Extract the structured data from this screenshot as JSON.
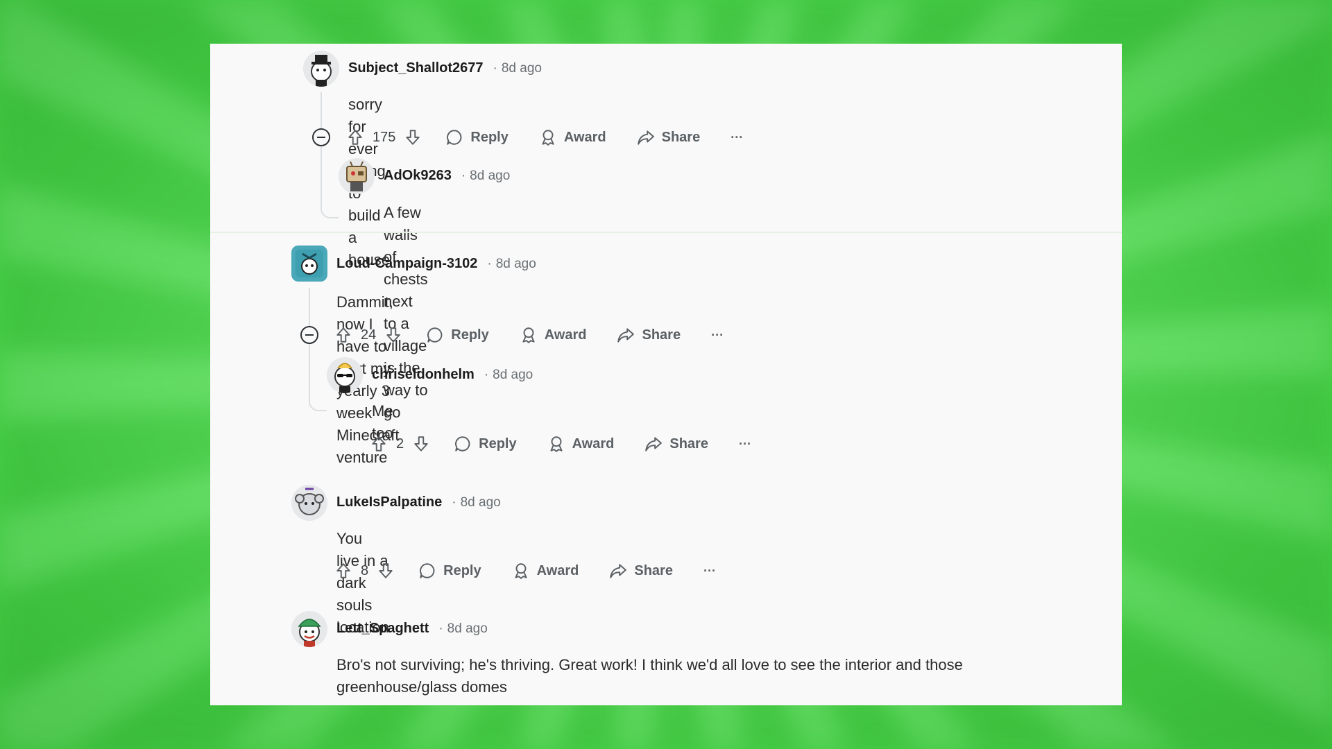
{
  "comments": [
    {
      "user": "Subject_Shallot2677",
      "time": "8d ago",
      "body": "sorry for ever trying to build a house",
      "score": "175",
      "reply_label": "Reply",
      "award_label": "Award",
      "share_label": "Share",
      "more_label": "···",
      "avatar_icon": "snoo-avatar-tophat-icon",
      "replies": [
        {
          "user": "AdOk9263",
          "time": "8d ago",
          "body": "A few walls of chests next to a village is the way to go",
          "avatar_icon": "snoo-avatar-tv-head-icon"
        }
      ]
    },
    {
      "user": "Loud-Campaign-3102",
      "time": "8d ago",
      "body": "Dammit, now I have to start my yearly 3 week Minecraft venture",
      "score": "24",
      "reply_label": "Reply",
      "award_label": "Award",
      "share_label": "Share",
      "more_label": "···",
      "avatar_icon": "snoo-avatar-teal-icon",
      "replies": [
        {
          "user": "chriseldonhelm",
          "time": "8d ago",
          "body": "Me too",
          "score": "2",
          "reply_label": "Reply",
          "award_label": "Award",
          "share_label": "Share",
          "more_label": "···",
          "avatar_icon": "snoo-avatar-sunglasses-icon"
        }
      ]
    },
    {
      "user": "LukeIsPalpatine",
      "time": "8d ago",
      "body": "You live in a dark souls location",
      "score": "8",
      "reply_label": "Reply",
      "award_label": "Award",
      "share_label": "Share",
      "more_label": "···",
      "avatar_icon": "snoo-avatar-gray-icon"
    },
    {
      "user": "Lett_Spaghett",
      "time": "8d ago",
      "body": "Bro's not surviving; he's thriving. Great work! I think we'd all love to see the interior and those greenhouse/glass domes",
      "avatar_icon": "snoo-avatar-green-hat-icon"
    }
  ],
  "separator": "·",
  "colors": {
    "background_green": "#5ee15e",
    "panel": "#f9f9f9",
    "text": "#1c1c1c",
    "meta": "#6a6f73"
  }
}
